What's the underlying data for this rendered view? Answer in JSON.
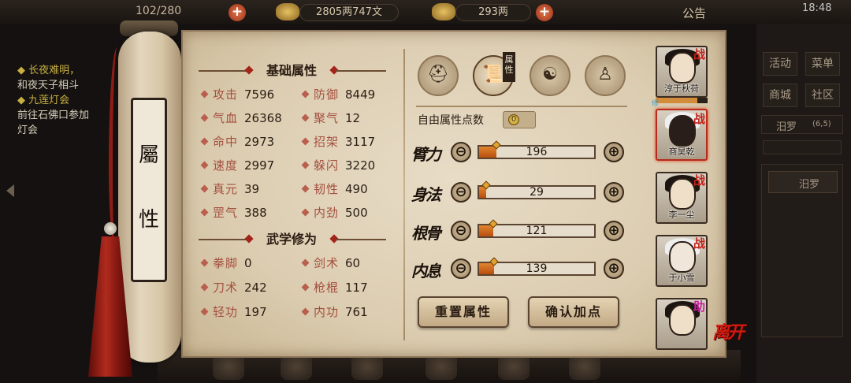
{
  "topbar": {
    "stamina": "102/280",
    "silver": "2805两747文",
    "gold": "293两",
    "notice": "公告",
    "time": "18:48"
  },
  "quests": [
    {
      "title": "◆ 长夜难明，",
      "desc": "和夜天子相斗"
    },
    {
      "title": "◆ 九莲灯会",
      "desc": "前往石佛口参加"
    },
    {
      "title": "",
      "desc": "灯会"
    }
  ],
  "scroll": {
    "title_chars": [
      "屬",
      "性"
    ]
  },
  "basic": {
    "header": "基础属性",
    "left": [
      {
        "label": "攻击",
        "value": "7596"
      },
      {
        "label": "气血",
        "value": "26368"
      },
      {
        "label": "命中",
        "value": "2973"
      },
      {
        "label": "速度",
        "value": "2997"
      },
      {
        "label": "真元",
        "value": "39"
      },
      {
        "label": "罡气",
        "value": "388"
      }
    ],
    "right": [
      {
        "label": "防御",
        "value": "8449"
      },
      {
        "label": "聚气",
        "value": "12"
      },
      {
        "label": "招架",
        "value": "3117"
      },
      {
        "label": "躲闪",
        "value": "3220"
      },
      {
        "label": "韧性",
        "value": "490"
      },
      {
        "label": "内劲",
        "value": "500"
      }
    ]
  },
  "martial": {
    "header": "武学修为",
    "left": [
      {
        "label": "拳脚",
        "value": "0"
      },
      {
        "label": "刀术",
        "value": "242"
      },
      {
        "label": "轻功",
        "value": "197"
      }
    ],
    "right": [
      {
        "label": "剑术",
        "value": "60"
      },
      {
        "label": "枪棍",
        "value": "117"
      },
      {
        "label": "内功",
        "value": "761"
      }
    ]
  },
  "tabs": {
    "active_flag": "属性",
    "icons": [
      "hat-icon",
      "scroll-map-icon",
      "yinyang-icon",
      "body-meridian-icon"
    ]
  },
  "free_points": {
    "label": "自由属性点数",
    "value": "0"
  },
  "stats": [
    {
      "name": "臂力",
      "value": "196",
      "fill": 0.15
    },
    {
      "name": "身法",
      "value": "29",
      "fill": 0.06
    },
    {
      "name": "根骨",
      "value": "121",
      "fill": 0.12
    },
    {
      "name": "内息",
      "value": "139",
      "fill": 0.13
    }
  ],
  "buttons": {
    "reset": "重置属性",
    "confirm": "确认加点",
    "minus": "⊖",
    "plus": "⊕"
  },
  "party": [
    {
      "name": "淳于秋荷",
      "badge": "战"
    },
    {
      "name": "商昊乾",
      "badge": "战"
    },
    {
      "name": "李一尘",
      "badge": "战"
    },
    {
      "name": "于小雪",
      "badge": "战"
    },
    {
      "name": "",
      "badge": "助"
    }
  ],
  "party_status_tag": "修",
  "leave_label": "离开",
  "right_menu": {
    "buttons": [
      "活动",
      "菜单",
      "商城",
      "社区"
    ],
    "location": "汨罗",
    "coords": "(6,5)",
    "sub_location": "汨罗"
  },
  "colors": {
    "accent_red": "#c3231a",
    "bar_orange": "#e0862f",
    "parchment": "#e8dcc6"
  }
}
